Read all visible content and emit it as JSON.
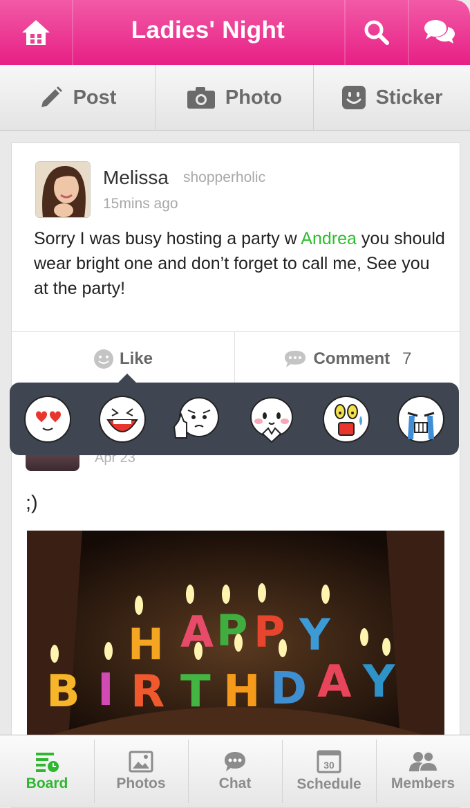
{
  "header": {
    "title": "Ladies' Night",
    "home_icon": "home-icon",
    "search_icon": "search-icon",
    "chat_icon": "chat-bubbles-icon",
    "color": "#e71f85"
  },
  "actions": [
    {
      "label": "Post",
      "icon": "pencil-icon"
    },
    {
      "label": "Photo",
      "icon": "camera-icon"
    },
    {
      "label": "Sticker",
      "icon": "sticker-icon"
    }
  ],
  "post": {
    "author": "Melissa",
    "role": "shopperholic",
    "time": "15mins ago",
    "text_before": "Sorry I was busy hosting a party w ",
    "mention": "Andrea",
    "text_after": " you should wear bright one and don’t forget to call me, See you at the party!",
    "like_label": "Like",
    "comment_label": "Comment",
    "comment_count": "7",
    "mention_color": "#2ebd2e"
  },
  "stickers": [
    "heart-eyes-sticker",
    "laughing-sticker",
    "thumbs-up-sticker",
    "blushing-sticker",
    "shocked-sticker",
    "crying-sticker"
  ],
  "post2": {
    "date": "Apr 23",
    "text": ";)"
  },
  "tabs": [
    {
      "label": "Board",
      "icon": "board-icon",
      "active": true
    },
    {
      "label": "Photos",
      "icon": "photos-icon",
      "active": false
    },
    {
      "label": "Chat",
      "icon": "chat-icon",
      "active": false
    },
    {
      "label": "Schedule",
      "icon": "calendar-icon",
      "calendar_day": "30",
      "active": false
    },
    {
      "label": "Members",
      "icon": "members-icon",
      "active": false
    }
  ]
}
